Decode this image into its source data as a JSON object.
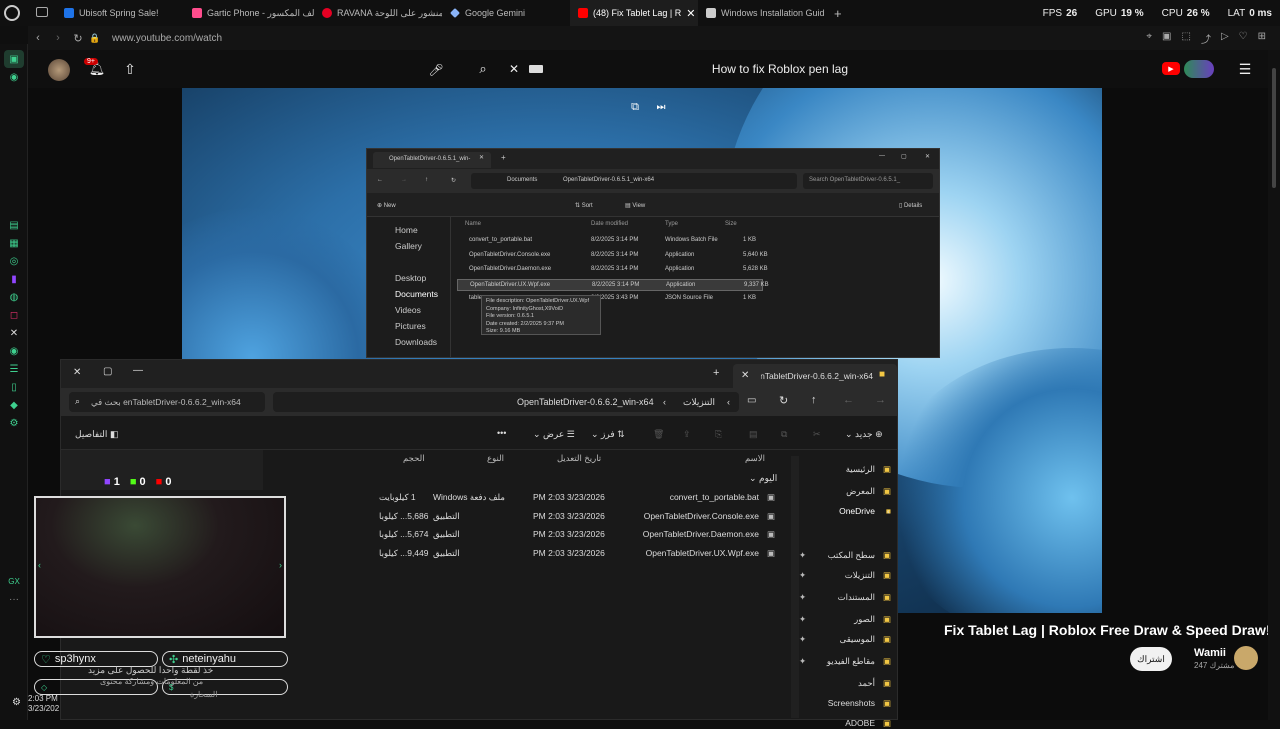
{
  "browser": {
    "tabs": [
      {
        "label": "Ubisoft Spring Sale!",
        "active": false,
        "color": "#1e73e8"
      },
      {
        "label": "Gartic Phone - لف المكسور",
        "active": false,
        "color": "#ff4d8d"
      },
      {
        "label": "RAVANA منشور على اللوحة",
        "active": false,
        "color": "#e60023"
      },
      {
        "label": "Google Gemini",
        "active": false,
        "color": "#8ab4f8"
      },
      {
        "label": "(48) Fix Tablet Lag | R",
        "active": true,
        "color": "#ff0000"
      },
      {
        "label": "Windows Installation Guid",
        "active": false,
        "color": "#cccccc"
      }
    ],
    "new_tab": "+",
    "stats": {
      "fps_label": "FPS",
      "fps": "26",
      "gpu_label": "GPU",
      "gpu": "19 %",
      "cpu_label": "CPU",
      "cpu": "26 %",
      "lat_label": "LAT",
      "lat": "0 ms"
    },
    "url": "www.youtube.com/watch"
  },
  "youtube": {
    "search_query": "How to fix Roblox pen lag",
    "notif_count": "9+",
    "video_title": "Fix Tablet Lag | Roblox Free Draw & Speed Draw!",
    "channel": "Wamii",
    "subscribers": "247 مشترك",
    "subscribe_label": "اشتراك"
  },
  "old_explorer": {
    "tab_title": "OpenTabletDriver-0.6.5.1_win-",
    "breadcrumb": [
      "Documents",
      "OpenTabletDriver-0.6.5.1_win-x64"
    ],
    "search_placeholder": "Search OpenTabletDriver-0.6.5.1_",
    "toolbar": {
      "new": "New",
      "sort": "Sort",
      "view": "View",
      "details": "Details"
    },
    "nav": [
      "Home",
      "Gallery",
      "Desktop",
      "Documents",
      "Videos",
      "Pictures",
      "Downloads"
    ],
    "columns": [
      "Name",
      "Date modified",
      "Type",
      "Size"
    ],
    "files": [
      {
        "name": "convert_to_portable.bat",
        "date": "8/2/2025 3:14 PM",
        "type": "Windows Batch File",
        "size": "1 KB"
      },
      {
        "name": "OpenTabletDriver.Console.exe",
        "date": "8/2/2025 3:14 PM",
        "type": "Application",
        "size": "5,640 KB"
      },
      {
        "name": "OpenTabletDriver.Daemon.exe",
        "date": "8/2/2025 3:14 PM",
        "type": "Application",
        "size": "5,628 KB"
      },
      {
        "name": "OpenTabletDriver.UX.Wpf.exe",
        "date": "8/2/2025 3:14 PM",
        "type": "Application",
        "size": "9,337 KB"
      },
      {
        "name": "table",
        "date": "8/2/2025 3:43 PM",
        "type": "JSON Source File",
        "size": "1 KB"
      }
    ],
    "tooltip": [
      "File description: OpenTabletDriver.UX.Wpf",
      "Company: InfinityGhost,X9VoiD",
      "File version: 0.6.5.1",
      "Date created: 2/2/2025 9:37 PM",
      "Size: 9.16 MB"
    ]
  },
  "new_explorer": {
    "tab_title": "OpenTabletDriver-0.6.6.2_win-x64",
    "breadcrumb_current": "OpenTabletDriver-0.6.6.2_win-x64",
    "breadcrumb_parent": "التنزيلات",
    "search_placeholder": "بحث في enTabletDriver-0.6.6.2_win-x64",
    "toolbar": {
      "new": "جديد",
      "sort": "فرز",
      "view": "عرض",
      "more": "•••",
      "details": "التفاصيل"
    },
    "columns": [
      "الاسم",
      "تاريخ التعديل",
      "النوع",
      "الحجم"
    ],
    "group": "اليوم",
    "files": [
      {
        "name": "convert_to_portable.bat",
        "date": "3/23/2026 2:03 PM",
        "type": "ملف دفعة Windows",
        "size": "1 كيلوبايت"
      },
      {
        "name": "OpenTabletDriver.Console.exe",
        "date": "3/23/2026 2:03 PM",
        "type": "التطبيق",
        "size": "5,686... كيلوبا"
      },
      {
        "name": "OpenTabletDriver.Daemon.exe",
        "date": "3/23/2026 2:03 PM",
        "type": "التطبيق",
        "size": "5,674... كيلوبا"
      },
      {
        "name": "OpenTabletDriver.UX.Wpf.exe",
        "date": "3/23/2026 2:03 PM",
        "type": "التطبيق",
        "size": "9,449... كيلوبا"
      }
    ],
    "nav": [
      "الرئيسية",
      "المعرض",
      "OneDrive",
      "سطح المكتب",
      "التنزيلات",
      "المستندات",
      "الصور",
      "الموسيقى",
      "مقاطع الفيديو",
      "أحمد",
      "Screenshots",
      "ADOBE"
    ]
  },
  "stream_overlay": {
    "counts": [
      {
        "value": "1",
        "color": "#9146ff"
      },
      {
        "value": "0",
        "color": "#53fc18"
      },
      {
        "value": "0",
        "color": "#ff0000"
      }
    ],
    "chat": [
      {
        "user": "sp3hynx",
        "message": "خذ لقطة واحدا للحصول على مزيد"
      },
      {
        "user": "neteinyahu",
        "message": "من المعلومات ومشاركة محتوى"
      },
      {
        "user": "",
        "message": "السحارة"
      }
    ]
  },
  "taskbar": {
    "time": "2:03 PM",
    "date": "3/23/202"
  }
}
